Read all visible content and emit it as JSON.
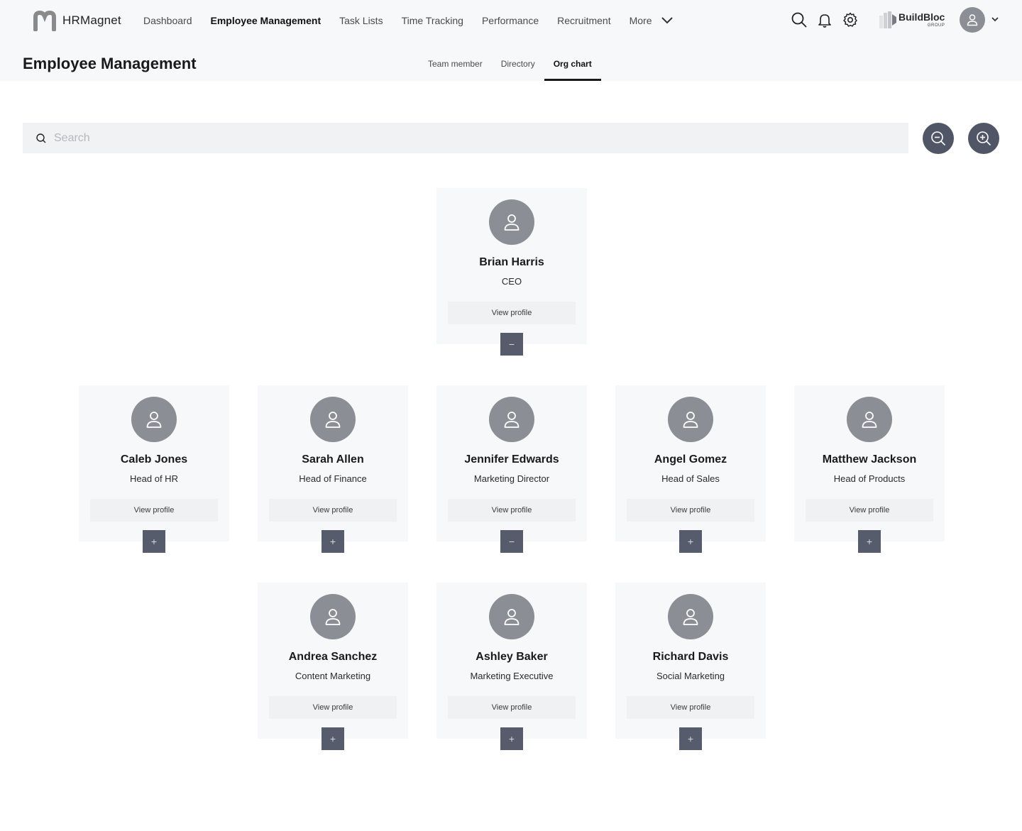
{
  "app": {
    "name": "HRMagnet",
    "brand_name": "BuildBloc",
    "brand_sub": "GROUP"
  },
  "nav": {
    "items": [
      {
        "label": "Dashboard",
        "active": false
      },
      {
        "label": "Employee Management",
        "active": true
      },
      {
        "label": "Task Lists",
        "active": false
      },
      {
        "label": "Time Tracking",
        "active": false
      },
      {
        "label": "Performance",
        "active": false
      },
      {
        "label": "Recruitment",
        "active": false
      }
    ],
    "more_label": "More"
  },
  "header_icons": [
    "search-icon",
    "bell-icon",
    "gear-icon"
  ],
  "page": {
    "title": "Employee Management",
    "subtabs": [
      {
        "label": "Team member",
        "active": false
      },
      {
        "label": "Directory",
        "active": false
      },
      {
        "label": "Org chart",
        "active": true
      }
    ]
  },
  "search": {
    "placeholder": "Search",
    "value": ""
  },
  "zoom_controls": {
    "zoom_out": "zoom-out",
    "zoom_in": "zoom-in"
  },
  "org": {
    "view_profile_label": "View profile",
    "level1": [
      {
        "name": "Brian Harris",
        "role": "CEO",
        "expanded": true,
        "toggle": "−"
      }
    ],
    "level2": [
      {
        "name": "Caleb Jones",
        "role": "Head of HR",
        "expanded": false,
        "toggle": "+"
      },
      {
        "name": "Sarah Allen",
        "role": "Head of Finance",
        "expanded": false,
        "toggle": "+"
      },
      {
        "name": "Jennifer Edwards",
        "role": "Marketing Director",
        "expanded": true,
        "toggle": "−"
      },
      {
        "name": "Angel Gomez",
        "role": "Head of Sales",
        "expanded": false,
        "toggle": "+"
      },
      {
        "name": "Matthew Jackson",
        "role": "Head of Products",
        "expanded": false,
        "toggle": "+"
      }
    ],
    "level3": [
      {
        "name": "Andrea Sanchez",
        "role": "Content Marketing",
        "expanded": false,
        "toggle": "+"
      },
      {
        "name": "Ashley Baker",
        "role": "Marketing Executive",
        "expanded": false,
        "toggle": "+"
      },
      {
        "name": "Richard Davis",
        "role": "Social Marketing",
        "expanded": false,
        "toggle": "+"
      }
    ]
  }
}
